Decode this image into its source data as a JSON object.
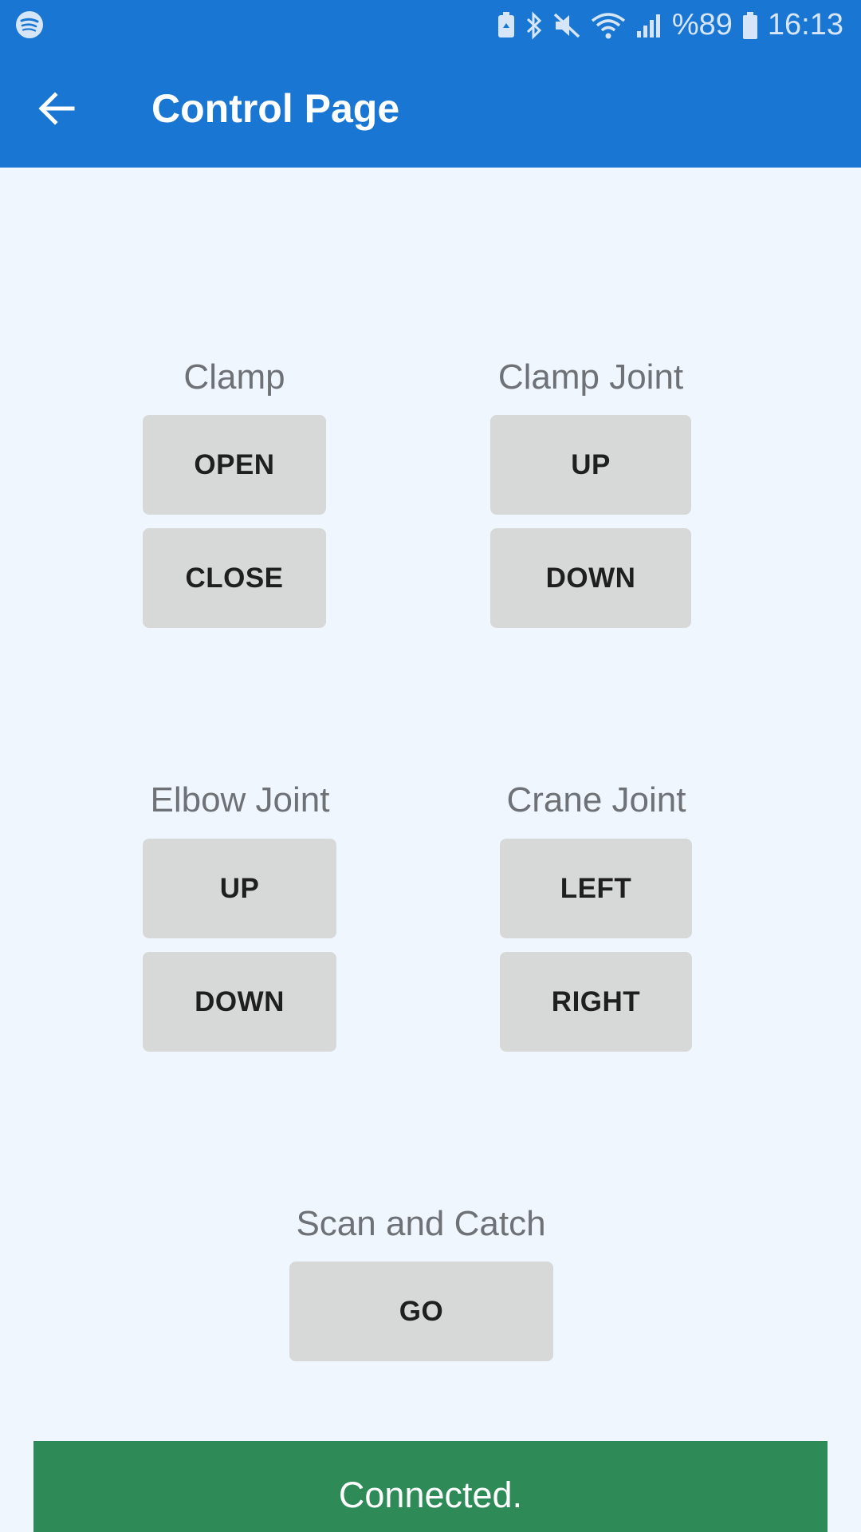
{
  "status_bar": {
    "battery_percent": "%89",
    "time": "16:13",
    "icons": [
      "spotify-icon",
      "battery-saver-icon",
      "bluetooth-icon",
      "mute-icon",
      "wifi-icon",
      "signal-icon",
      "battery-icon"
    ]
  },
  "app_bar": {
    "title": "Control Page",
    "back_icon": "arrow-left-icon",
    "color": "#1976d2"
  },
  "sections": {
    "clamp": {
      "label": "Clamp",
      "open": "OPEN",
      "close": "CLOSE"
    },
    "clamp_joint": {
      "label": "Clamp Joint",
      "up": "UP",
      "down": "DOWN"
    },
    "elbow_joint": {
      "label": "Elbow Joint",
      "up": "UP",
      "down": "DOWN"
    },
    "crane_joint": {
      "label": "Crane Joint",
      "left": "LEFT",
      "right": "RIGHT"
    },
    "scan": {
      "label": "Scan and Catch",
      "go": "GO"
    }
  },
  "connection_status": {
    "text": "Connected.",
    "color": "#2e8b57"
  }
}
